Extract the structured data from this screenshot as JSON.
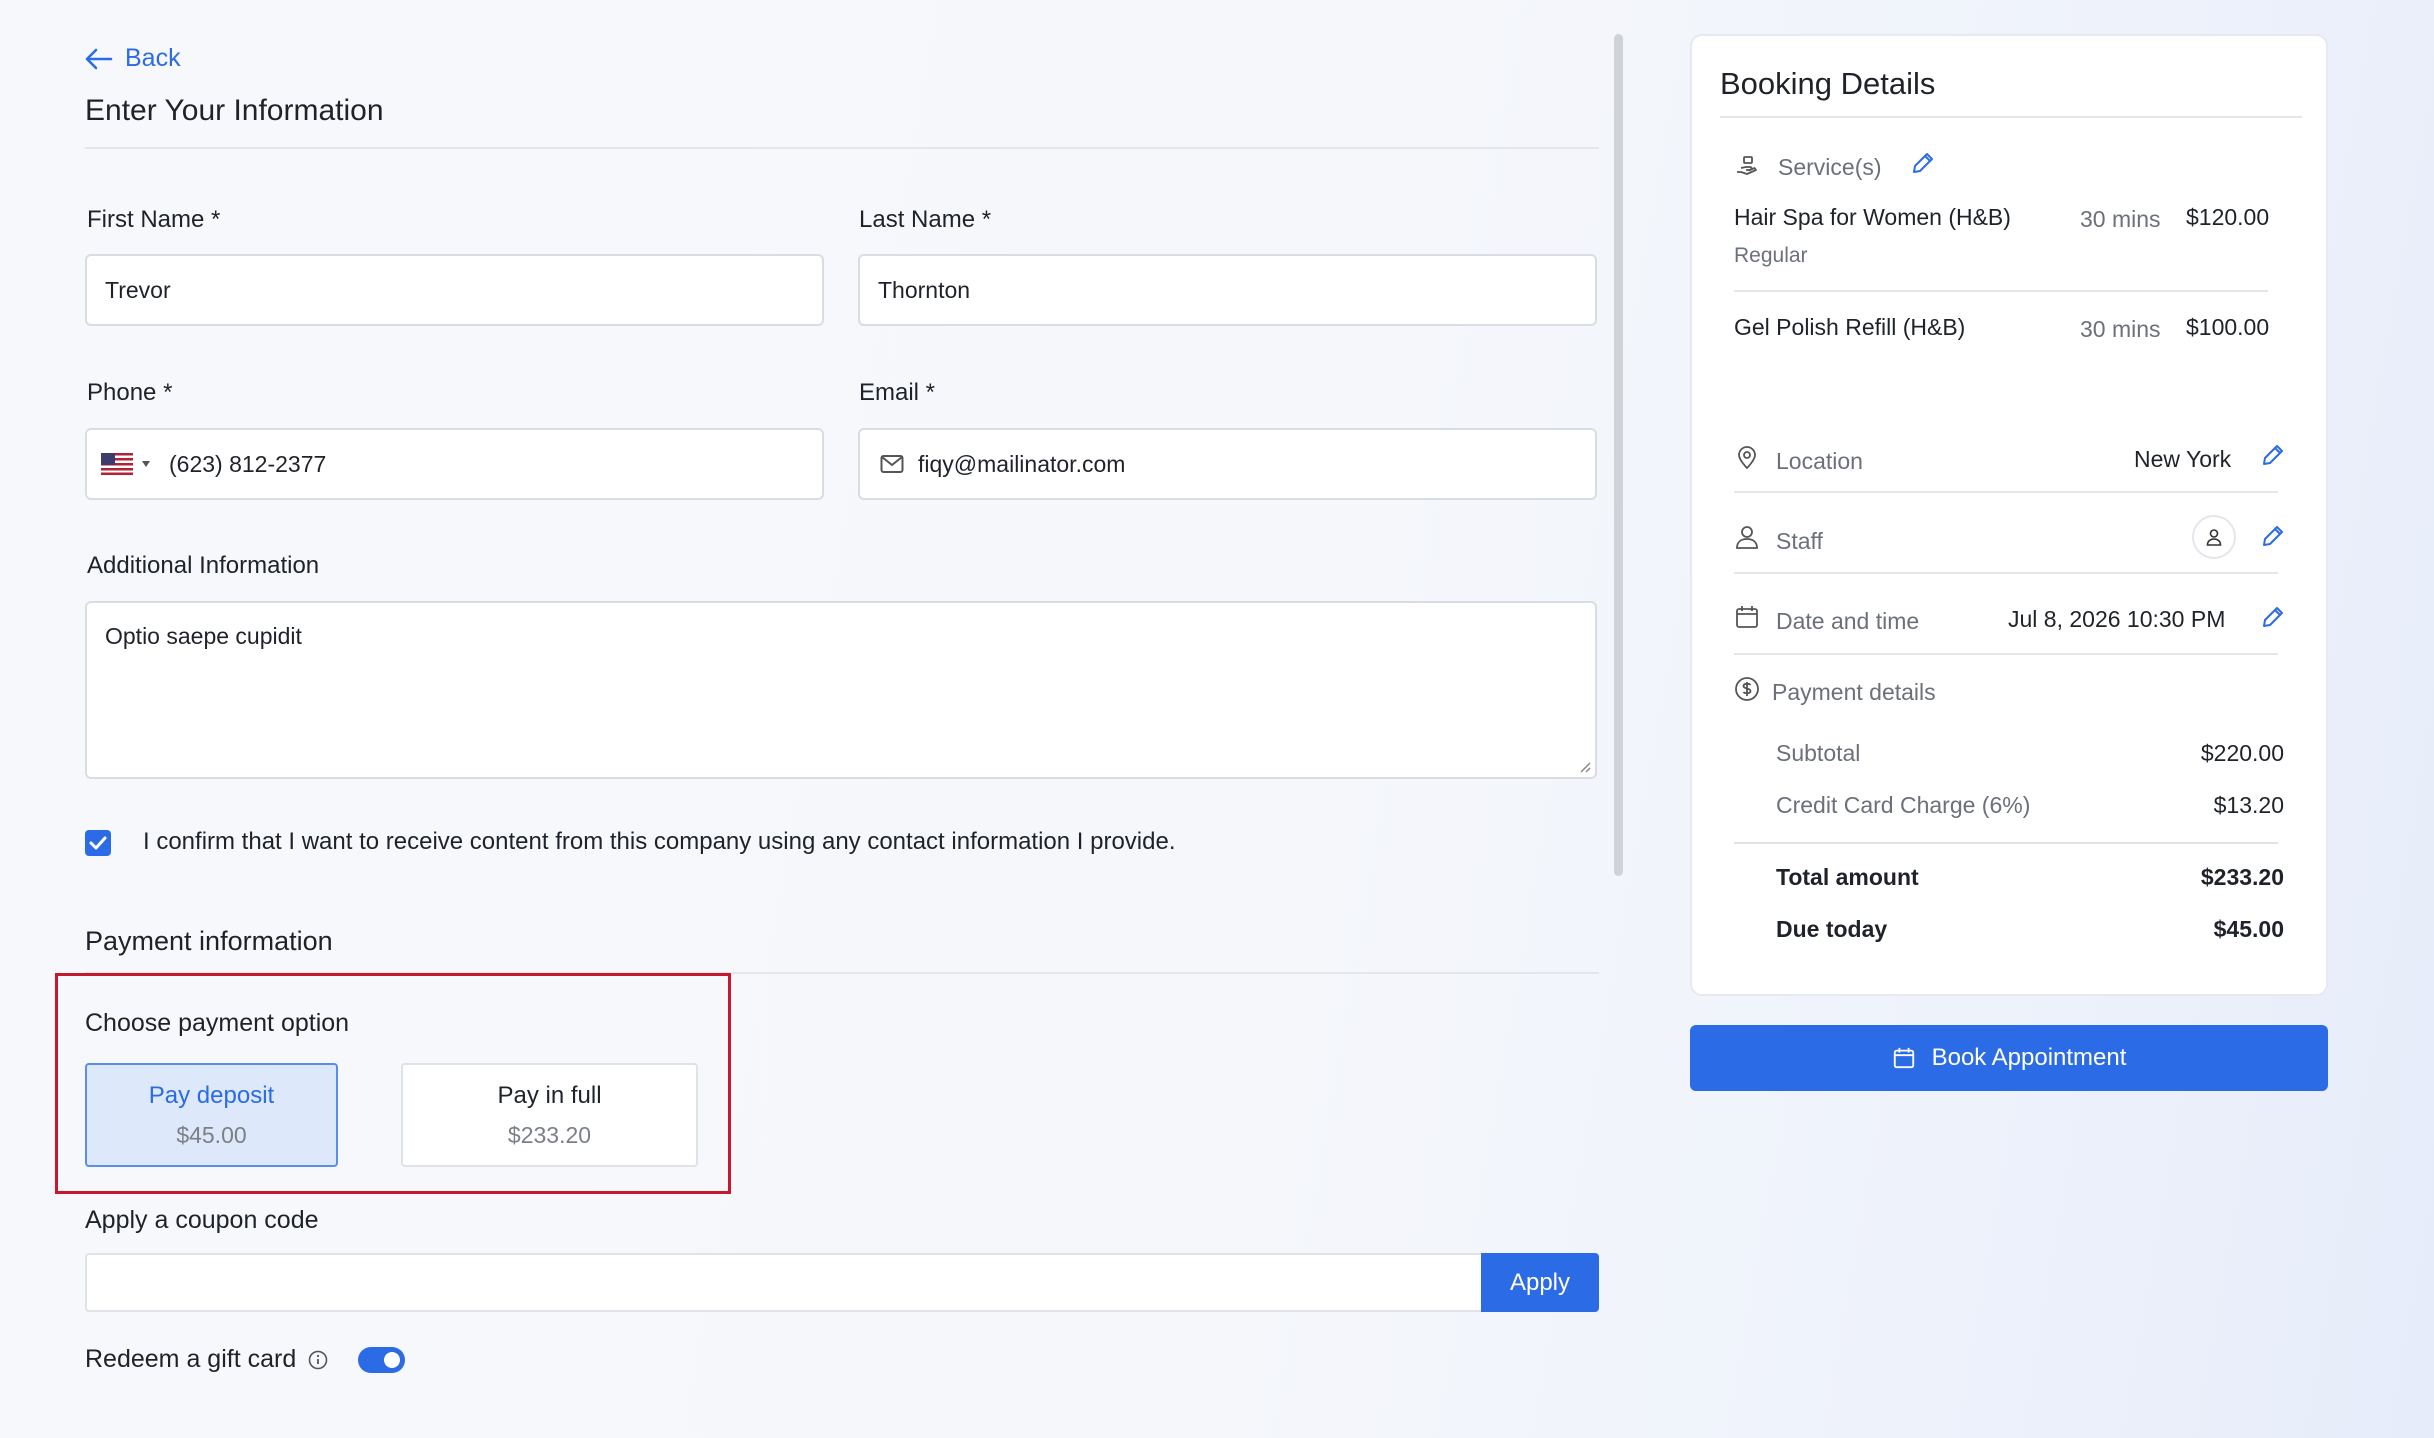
{
  "form": {
    "back_label": "Back",
    "title": "Enter Your Information",
    "first_name": {
      "label": "First Name *",
      "value": "Trevor"
    },
    "last_name": {
      "label": "Last Name *",
      "value": "Thornton"
    },
    "phone": {
      "label": "Phone *",
      "value": "(623) 812-2377",
      "country": "US"
    },
    "email": {
      "label": "Email *",
      "value": "fiqy@mailinator.com"
    },
    "additional": {
      "label": "Additional Information",
      "value": "Optio saepe cupidit"
    },
    "consent": {
      "checked": true,
      "text": "I confirm that I want to receive content from this company using any contact information I provide."
    }
  },
  "payment": {
    "section_title": "Payment information",
    "choose_label": "Choose payment option",
    "options": [
      {
        "label": "Pay deposit",
        "amount": "$45.00",
        "selected": true
      },
      {
        "label": "Pay in full",
        "amount": "$233.20",
        "selected": false
      }
    ],
    "coupon_label": "Apply a coupon code",
    "apply_label": "Apply",
    "gift_label": "Redeem a gift card",
    "gift_enabled": true
  },
  "booking": {
    "title": "Booking Details",
    "services_label": "Service(s)",
    "services": [
      {
        "name": "Hair Spa for Women (H&B)",
        "variant": "Regular",
        "duration": "30 mins",
        "price": "$120.00"
      },
      {
        "name": "Gel Polish Refill (H&B)",
        "variant": "",
        "duration": "30 mins",
        "price": "$100.00"
      }
    ],
    "location_label": "Location",
    "location_value": "New York",
    "staff_label": "Staff",
    "datetime_label": "Date and time",
    "datetime_value": "Jul 8, 2026 10:30 PM",
    "payment_details_label": "Payment details",
    "subtotal_label": "Subtotal",
    "subtotal_value": "$220.00",
    "cc_label": "Credit Card Charge (6%)",
    "cc_value": "$13.20",
    "total_label": "Total amount",
    "total_value": "$233.20",
    "due_label": "Due today",
    "due_value": "$45.00"
  },
  "book_button_label": "Book Appointment",
  "colors": {
    "accent": "#2b6be6",
    "highlight_border": "#c8182d"
  }
}
